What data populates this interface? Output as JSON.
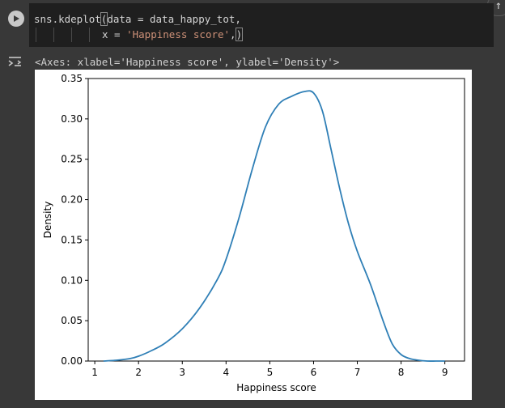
{
  "code": {
    "line1_prefix": "sns.kdeplot",
    "line1_paren": "(",
    "line1_rest": "data = data_happy_tot,",
    "line2_prefix": "x =",
    "line2_string": "'Happiness score'",
    "line2_comma": ",",
    "line2_close": ")"
  },
  "output": {
    "repr": "<Axes: xlabel='Happiness score', ylabel='Density'>"
  },
  "icons": {
    "run": "play-icon",
    "output": "output-toggle-icon",
    "scroll": "arrow-up-icon"
  },
  "chart_data": {
    "type": "line",
    "title": "",
    "xlabel": "Happiness score",
    "ylabel": "Density",
    "xlim": [
      0.85,
      9.45
    ],
    "ylim": [
      0,
      0.35
    ],
    "xticks": [
      "1",
      "2",
      "3",
      "4",
      "5",
      "6",
      "7",
      "8",
      "9"
    ],
    "yticks": [
      "0.00",
      "0.05",
      "0.10",
      "0.15",
      "0.20",
      "0.25",
      "0.30",
      "0.35"
    ],
    "grid": false,
    "color": "#2f7fb6",
    "series": [
      {
        "x": [
          1.2,
          1.5,
          1.8,
          2.0,
          2.3,
          2.6,
          3.0,
          3.4,
          3.8,
          4.0,
          4.3,
          4.6,
          4.9,
          5.2,
          5.5,
          5.8,
          6.0,
          6.2,
          6.4,
          6.6,
          6.8,
          7.0,
          7.3,
          7.6,
          7.8,
          8.0,
          8.2,
          8.4,
          8.6,
          8.8,
          9.0
        ],
        "y": [
          0.0,
          0.001,
          0.003,
          0.006,
          0.013,
          0.022,
          0.04,
          0.066,
          0.101,
          0.126,
          0.178,
          0.238,
          0.29,
          0.318,
          0.328,
          0.334,
          0.332,
          0.31,
          0.262,
          0.213,
          0.17,
          0.136,
          0.095,
          0.048,
          0.021,
          0.008,
          0.003,
          0.001,
          0.0,
          0.0,
          0.0
        ]
      }
    ]
  }
}
